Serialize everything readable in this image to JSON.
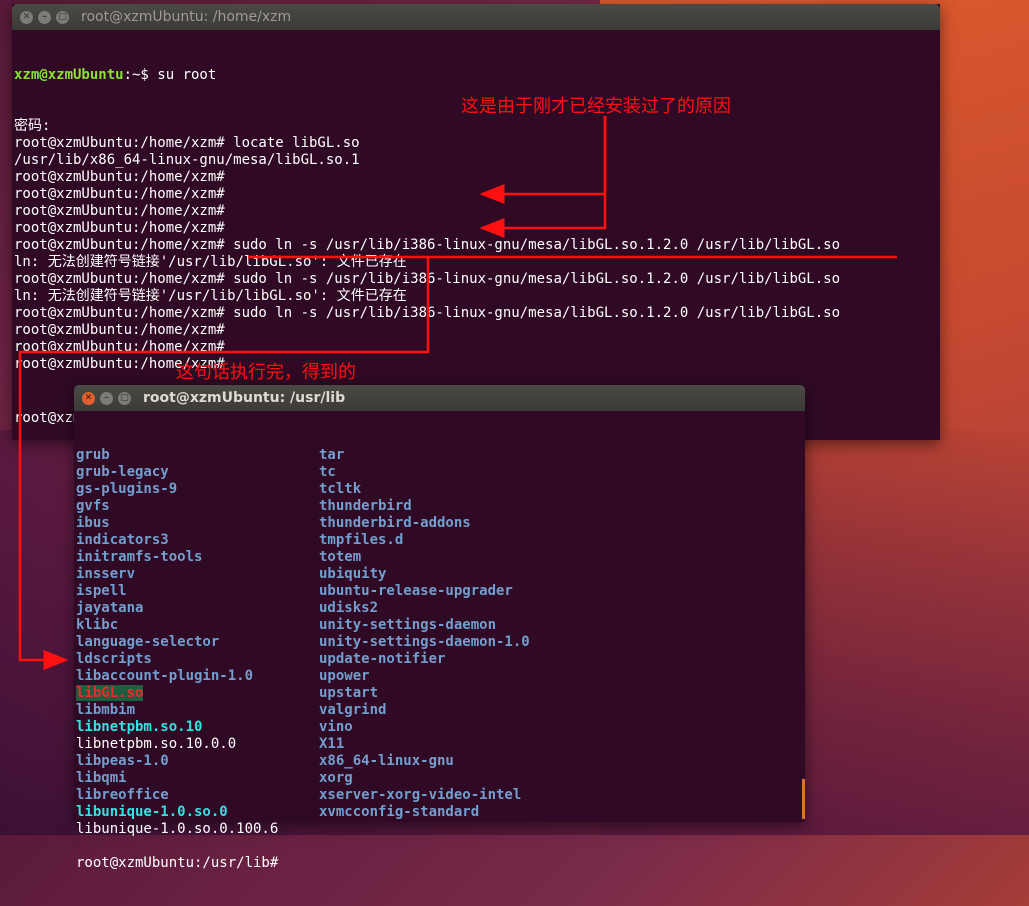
{
  "window1": {
    "title": "root@xzmUbuntu: /home/xzm",
    "user_host": "xzm@xzmUbuntu",
    "prompt_suffix": ":~$ su root",
    "lines": [
      "密码:",
      "root@xzmUbuntu:/home/xzm# locate libGL.so",
      "/usr/lib/x86_64-linux-gnu/mesa/libGL.so.1",
      "root@xzmUbuntu:/home/xzm#",
      "root@xzmUbuntu:/home/xzm#",
      "root@xzmUbuntu:/home/xzm#",
      "root@xzmUbuntu:/home/xzm#",
      "root@xzmUbuntu:/home/xzm# sudo ln -s /usr/lib/i386-linux-gnu/mesa/libGL.so.1.2.0 /usr/lib/libGL.so",
      "ln: 无法创建符号链接'/usr/lib/libGL.so': 文件已存在",
      "root@xzmUbuntu:/home/xzm# sudo ln -s /usr/lib/i386-linux-gnu/mesa/libGL.so.1.2.0 /usr/lib/libGL.so",
      "ln: 无法创建符号链接'/usr/lib/libGL.so': 文件已存在",
      "root@xzmUbuntu:/home/xzm# sudo ln -s /usr/lib/i386-linux-gnu/mesa/libGL.so.1.2.0 /usr/lib/libGL.so",
      "root@xzmUbuntu:/home/xzm#",
      "root@xzmUbuntu:/home/xzm#",
      "root@xzmUbuntu:/home/xzm#"
    ],
    "last_prompt": "root@xzmUbuntu:/home/xzm# "
  },
  "window2": {
    "title": "root@xzmUbuntu: /usr/lib",
    "left_col": [
      {
        "text": "grub",
        "style": "bl"
      },
      {
        "text": "grub-legacy",
        "style": "bl"
      },
      {
        "text": "gs-plugins-9",
        "style": "bl"
      },
      {
        "text": "gvfs",
        "style": "bl"
      },
      {
        "text": "ibus",
        "style": "bl"
      },
      {
        "text": "indicators3",
        "style": "bl"
      },
      {
        "text": "initramfs-tools",
        "style": "bl"
      },
      {
        "text": "insserv",
        "style": "bl"
      },
      {
        "text": "ispell",
        "style": "bl"
      },
      {
        "text": "jayatana",
        "style": "bl"
      },
      {
        "text": "klibc",
        "style": "bl"
      },
      {
        "text": "language-selector",
        "style": "bl"
      },
      {
        "text": "ldscripts",
        "style": "bl"
      },
      {
        "text": "libaccount-plugin-1.0",
        "style": "bl"
      },
      {
        "text": "libGL.so",
        "style": "rd"
      },
      {
        "text": "libmbim",
        "style": "bl"
      },
      {
        "text": "libnetpbm.so.10",
        "style": "cy"
      },
      {
        "text": "libnetpbm.so.10.0.0",
        "style": "wt"
      },
      {
        "text": "libpeas-1.0",
        "style": "bl"
      },
      {
        "text": "libqmi",
        "style": "bl"
      },
      {
        "text": "libreoffice",
        "style": "bl"
      },
      {
        "text": "libunique-1.0.so.0",
        "style": "cy"
      },
      {
        "text": "libunique-1.0.so.0.100.6",
        "style": "wt"
      }
    ],
    "right_col": [
      {
        "text": "tar",
        "style": "bl"
      },
      {
        "text": "tc",
        "style": "bl"
      },
      {
        "text": "tcltk",
        "style": "bl"
      },
      {
        "text": "thunderbird",
        "style": "bl"
      },
      {
        "text": "thunderbird-addons",
        "style": "bl"
      },
      {
        "text": "tmpfiles.d",
        "style": "bl"
      },
      {
        "text": "totem",
        "style": "bl"
      },
      {
        "text": "ubiquity",
        "style": "bl"
      },
      {
        "text": "ubuntu-release-upgrader",
        "style": "bl"
      },
      {
        "text": "udisks2",
        "style": "bl"
      },
      {
        "text": "unity-settings-daemon",
        "style": "bl"
      },
      {
        "text": "unity-settings-daemon-1.0",
        "style": "bl"
      },
      {
        "text": "update-notifier",
        "style": "bl"
      },
      {
        "text": "upower",
        "style": "bl"
      },
      {
        "text": "upstart",
        "style": "bl"
      },
      {
        "text": "valgrind",
        "style": "bl"
      },
      {
        "text": "vino",
        "style": "bl"
      },
      {
        "text": "X11",
        "style": "bl"
      },
      {
        "text": "x86_64-linux-gnu",
        "style": "bl"
      },
      {
        "text": "xorg",
        "style": "bl"
      },
      {
        "text": "xserver-xorg-video-intel",
        "style": "bl"
      },
      {
        "text": "xvmcconfig-standard",
        "style": "bl"
      }
    ],
    "prompt": "root@xzmUbuntu:/usr/lib#"
  },
  "annotations": {
    "reason": "这是由于刚才已经安装过了的原因",
    "result": "这句话执行完，得到的"
  },
  "colors": {
    "terminal_bg": "#300a24",
    "annotation": "#ff1010",
    "dir_blue": "#729fcf",
    "link_cyan": "#34e2e2",
    "user_green": "#8ae234"
  }
}
